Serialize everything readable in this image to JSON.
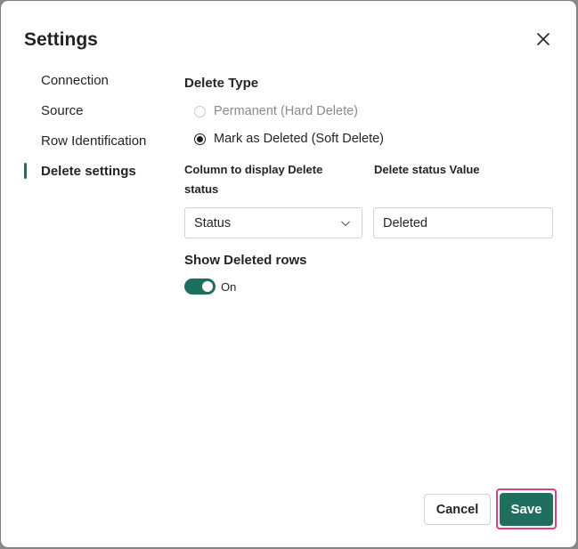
{
  "dialog": {
    "title": "Settings",
    "close_icon": "close-icon"
  },
  "nav": {
    "items": [
      {
        "label": "Connection"
      },
      {
        "label": "Source"
      },
      {
        "label": "Row Identification"
      },
      {
        "label": "Delete settings",
        "active": true
      }
    ]
  },
  "delete_type": {
    "title": "Delete Type",
    "options": [
      {
        "label": "Permanent (Hard Delete)",
        "checked": false,
        "disabled": true
      },
      {
        "label": "Mark as Deleted (Soft Delete)",
        "checked": true,
        "disabled": false
      }
    ]
  },
  "column_field": {
    "label": "Column to display Delete status",
    "value": "Status"
  },
  "status_value_field": {
    "label": "Delete status Value",
    "value": "Deleted"
  },
  "show_deleted": {
    "title": "Show Deleted rows",
    "state_label": "On",
    "enabled": true
  },
  "footer": {
    "cancel_label": "Cancel",
    "save_label": "Save"
  },
  "colors": {
    "accent": "#1f6e5f",
    "highlight": "#e0407a"
  }
}
